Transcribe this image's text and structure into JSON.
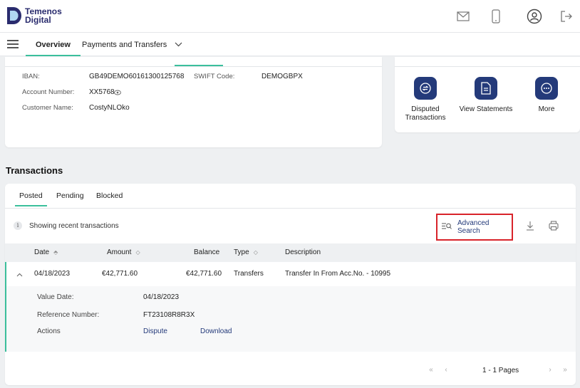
{
  "header": {
    "logo_line1": "Temenos",
    "logo_line2": "Digital",
    "icons": [
      "mail-icon",
      "mobile-icon",
      "profile-icon",
      "logout-icon"
    ]
  },
  "nav": {
    "tabs": [
      {
        "label": "Overview",
        "active": true
      },
      {
        "label": "Payments and Transfers",
        "active": false
      }
    ]
  },
  "account": {
    "iban_label": "IBAN:",
    "iban_value": "GB49DEMO60161300125768",
    "swift_label": "SWIFT Code:",
    "swift_value": "DEMOGBPX",
    "number_label": "Account Number:",
    "number_value": "XX5768",
    "customer_label": "Customer Name:",
    "customer_value": "CostyNLOko"
  },
  "quick_actions": [
    {
      "label": "Disputed Transactions",
      "icon": "dispute-icon"
    },
    {
      "label": "View Statements",
      "icon": "statement-icon"
    },
    {
      "label": "More",
      "icon": "more-icon"
    }
  ],
  "transactions": {
    "title": "Transactions",
    "tabs": [
      {
        "label": "Posted",
        "active": true
      },
      {
        "label": "Pending",
        "active": false
      },
      {
        "label": "Blocked",
        "active": false
      }
    ],
    "info": "Showing recent transactions",
    "advanced_search": "Advanced Search",
    "columns": [
      "Date",
      "Amount",
      "Balance",
      "Type",
      "Description"
    ],
    "rows": [
      {
        "date": "04/18/2023",
        "amount": "€42,771.60",
        "balance": "€42,771.60",
        "type": "Transfers",
        "description": "Transfer In From Acc.No. - 10995"
      }
    ],
    "detail": {
      "value_date_label": "Value Date:",
      "value_date": "04/18/2023",
      "reference_label": "Reference Number:",
      "reference": "FT23108R8R3X",
      "actions_label": "Actions",
      "dispute": "Dispute",
      "download": "Download"
    },
    "pagination": "1 - 1 Pages"
  },
  "colors": {
    "accent": "#3bbf9c",
    "brand_navy": "#243a7a",
    "highlight_box": "#d8232a"
  }
}
